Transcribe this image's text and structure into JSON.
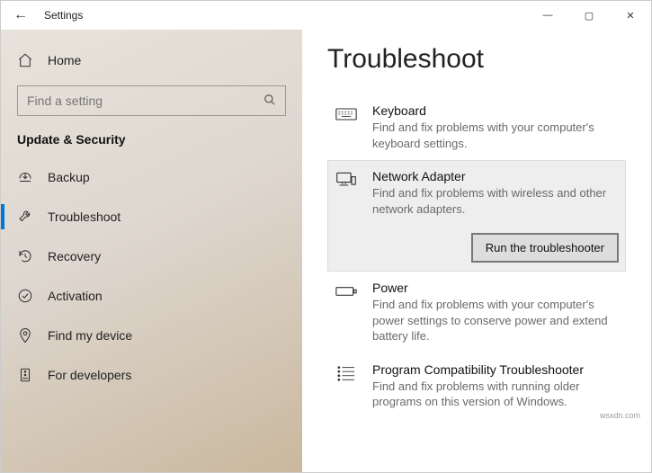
{
  "titlebar": {
    "back_icon": "←",
    "title": "Settings",
    "minimize": "—",
    "maximize": "▢",
    "close": "✕"
  },
  "sidebar": {
    "home_label": "Home",
    "search_placeholder": "Find a setting",
    "section_header": "Update & Security",
    "items": [
      {
        "label": "Backup"
      },
      {
        "label": "Troubleshoot"
      },
      {
        "label": "Recovery"
      },
      {
        "label": "Activation"
      },
      {
        "label": "Find my device"
      },
      {
        "label": "For developers"
      }
    ]
  },
  "main": {
    "heading": "Troubleshoot",
    "items": [
      {
        "title": "Keyboard",
        "desc": "Find and fix problems with your computer's keyboard settings."
      },
      {
        "title": "Network Adapter",
        "desc": "Find and fix problems with wireless and other network adapters.",
        "run_label": "Run the troubleshooter"
      },
      {
        "title": "Power",
        "desc": "Find and fix problems with your computer's power settings to conserve power and extend battery life."
      },
      {
        "title": "Program Compatibility Troubleshooter",
        "desc": "Find and fix problems with running older programs on this version of Windows."
      }
    ]
  },
  "watermark": "wsxdn.com"
}
